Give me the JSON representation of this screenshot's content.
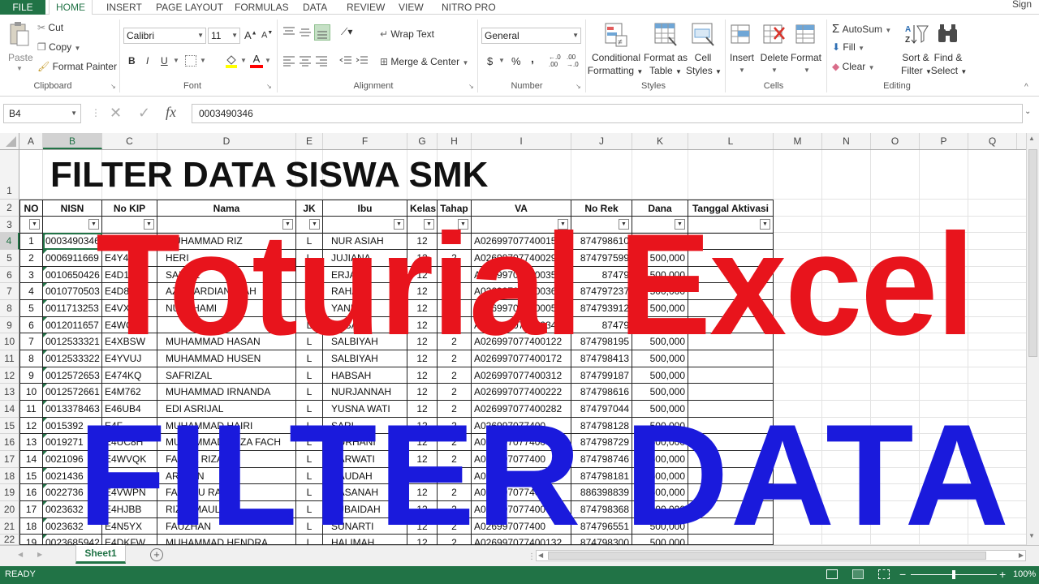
{
  "menu": {
    "file": "FILE",
    "tabs": [
      "HOME",
      "INSERT",
      "PAGE LAYOUT",
      "FORMULAS",
      "DATA",
      "REVIEW",
      "VIEW",
      "NITRO PRO"
    ],
    "sign_in": "Sign in"
  },
  "ribbon": {
    "clipboard": {
      "paste": "Paste",
      "cut": "Cut",
      "copy": "Copy",
      "format_painter": "Format Painter",
      "label": "Clipboard"
    },
    "font": {
      "name": "Calibri",
      "size": "11",
      "bold": "B",
      "italic": "I",
      "underline": "U",
      "label": "Font"
    },
    "alignment": {
      "wrap": "Wrap Text",
      "merge": "Merge & Center",
      "label": "Alignment"
    },
    "number": {
      "format": "General",
      "currency": "$",
      "percent": "%",
      "comma": ",",
      "inc": "←.0 .00",
      "dec": ".00 →.0",
      "label": "Number"
    },
    "styles": {
      "conditional": "Conditional",
      "conditional2": "Formatting",
      "format_table": "Format as",
      "format_table2": "Table",
      "cell_styles": "Cell",
      "cell_styles2": "Styles",
      "label": "Styles"
    },
    "cells": {
      "insert": "Insert",
      "delete": "Delete",
      "format": "Format",
      "label": "Cells"
    },
    "editing": {
      "autosum": "AutoSum",
      "fill": "Fill",
      "clear": "Clear",
      "sort": "Sort &",
      "sort2": "Filter",
      "find": "Find &",
      "find2": "Select",
      "label": "Editing"
    }
  },
  "formula_bar": {
    "name_box": "B4",
    "fx": "fx",
    "value": "0003490346"
  },
  "columns": [
    "A",
    "B",
    "C",
    "D",
    "E",
    "F",
    "G",
    "H",
    "I",
    "J",
    "K",
    "L",
    "M",
    "N",
    "O",
    "P",
    "Q"
  ],
  "row_numbers": [
    "1",
    "2",
    "3",
    "4",
    "5",
    "6",
    "7",
    "8",
    "9",
    "10",
    "11",
    "12",
    "13",
    "14",
    "15",
    "16",
    "17",
    "18",
    "19",
    "20",
    "21",
    "22"
  ],
  "sheet": {
    "title": "FILTER DATA SISWA SMK",
    "headers": [
      "NO",
      "NISN",
      "No KIP",
      "Nama",
      "JK",
      "Ibu",
      "Kelas",
      "Tahap",
      "VA",
      "No Rek",
      "Dana",
      "Tanggal Aktivasi"
    ],
    "rows": [
      [
        "1",
        "0003490346",
        "E4P",
        "MUHAMMAD RIZ",
        "L",
        "NUR ASIAH",
        "12",
        "2",
        "A026997077400152",
        "874798610",
        "500,000",
        ""
      ],
      [
        "2",
        "0006911669",
        "E4Y4H",
        "HERI",
        "L",
        "JUJIANA",
        "12",
        "2",
        "A026997077400292",
        "874797599",
        "500,000",
        ""
      ],
      [
        "3",
        "0010650426",
        "E4D12",
        "SAIFUL",
        "L",
        "ERJANI",
        "12",
        "2",
        "A026997077400352",
        "87479",
        "500,000",
        ""
      ],
      [
        "4",
        "0010770503",
        "E4D8R",
        "AZAR ARDIANSYAH",
        "L",
        "RAHAYU",
        "12",
        "2",
        "A026997077400362",
        "874797237",
        "500,000",
        ""
      ],
      [
        "5",
        "0011713253",
        "E4VXJ",
        "NURTHAMI",
        "L",
        "YANI",
        "12",
        "2",
        "A026997077400052",
        "874793912",
        "500,000",
        ""
      ],
      [
        "6",
        "0012011657",
        "E4WG6",
        "",
        "L",
        "ERBAYA",
        "12",
        "2",
        "A026997077400342",
        "87479",
        "500,000",
        ""
      ],
      [
        "7",
        "0012533321",
        "E4XBSW",
        "MUHAMMAD HASAN",
        "L",
        "SALBIYAH",
        "12",
        "2",
        "A026997077400122",
        "874798195",
        "500,000",
        ""
      ],
      [
        "8",
        "0012533322",
        "E4YVUJ",
        "MUHAMMAD HUSEN",
        "L",
        "SALBIYAH",
        "12",
        "2",
        "A026997077400172",
        "874798413",
        "500,000",
        ""
      ],
      [
        "9",
        "0012572653",
        "E474KQ",
        "SAFRIZAL",
        "L",
        "HABSAH",
        "12",
        "2",
        "A026997077400312",
        "874799187",
        "500,000",
        ""
      ],
      [
        "10",
        "0012572661",
        "E4M762",
        "MUHAMMAD IRNANDA",
        "L",
        "NURJANNAH",
        "12",
        "2",
        "A026997077400222",
        "874798616",
        "500,000",
        ""
      ],
      [
        "11",
        "0013378463",
        "E46UB4",
        "EDI ASRIJAL",
        "L",
        "YUSNA WATI",
        "12",
        "2",
        "A026997077400282",
        "874797044",
        "500,000",
        ""
      ],
      [
        "12",
        "0015392",
        "E4F",
        "MUHAMMAD HAIRI",
        "L",
        "SARI",
        "12",
        "2",
        "A026997077400",
        "874798128",
        "500,000",
        ""
      ],
      [
        "13",
        "0019271",
        "E4UC8H",
        "MUHAMMAD REZA FACH",
        "L",
        "NURHANI",
        "12",
        "2",
        "A026997077400",
        "874798729",
        "500,000",
        ""
      ],
      [
        "14",
        "0021096",
        "E4WVQK",
        "FAIZUL RIZAL",
        "L",
        "DARWATI",
        "12",
        "2",
        "A026997077400",
        "874798746",
        "500,000",
        ""
      ],
      [
        "15",
        "0021436",
        "E4SC",
        "ARAYAN",
        "L",
        "RAUDAH",
        "12",
        "2",
        "A026997077400",
        "874798181",
        "500,000",
        ""
      ],
      [
        "16",
        "0022736",
        "E4VWPN",
        "FAKHRU RAZI",
        "L",
        "HASANAH",
        "12",
        "2",
        "A026997077400",
        "886398839",
        "500,000",
        ""
      ],
      [
        "17",
        "0023632",
        "E4HJBB",
        "RIZKI MAULANA",
        "L",
        "ZUBAIDAH",
        "12",
        "2",
        "A026997077400",
        "874798368",
        "1,000,000",
        ""
      ],
      [
        "18",
        "0023632",
        "E4N5YX",
        "FAUZHAN",
        "L",
        "SUNARTI",
        "12",
        "2",
        "A026997077400",
        "874796551",
        "500,000",
        ""
      ],
      [
        "19",
        "0023685942",
        "E4DKFW",
        "MUHAMMAD HENDRA",
        "L",
        "HALIMAH",
        "12",
        "2",
        "A026997077400132",
        "874798300",
        "500,000",
        ""
      ]
    ]
  },
  "overlay": {
    "line1": "Toturial Excel",
    "line2": "FILTER DATA"
  },
  "tabs": {
    "sheet1": "Sheet1",
    "add": "+"
  },
  "status": {
    "ready": "READY",
    "zoom": "100%",
    "minus": "−",
    "plus": "+"
  },
  "colors": {
    "excel_green": "#217346",
    "overlay_red": "#e8141c",
    "overlay_blue": "#1a1adc"
  }
}
